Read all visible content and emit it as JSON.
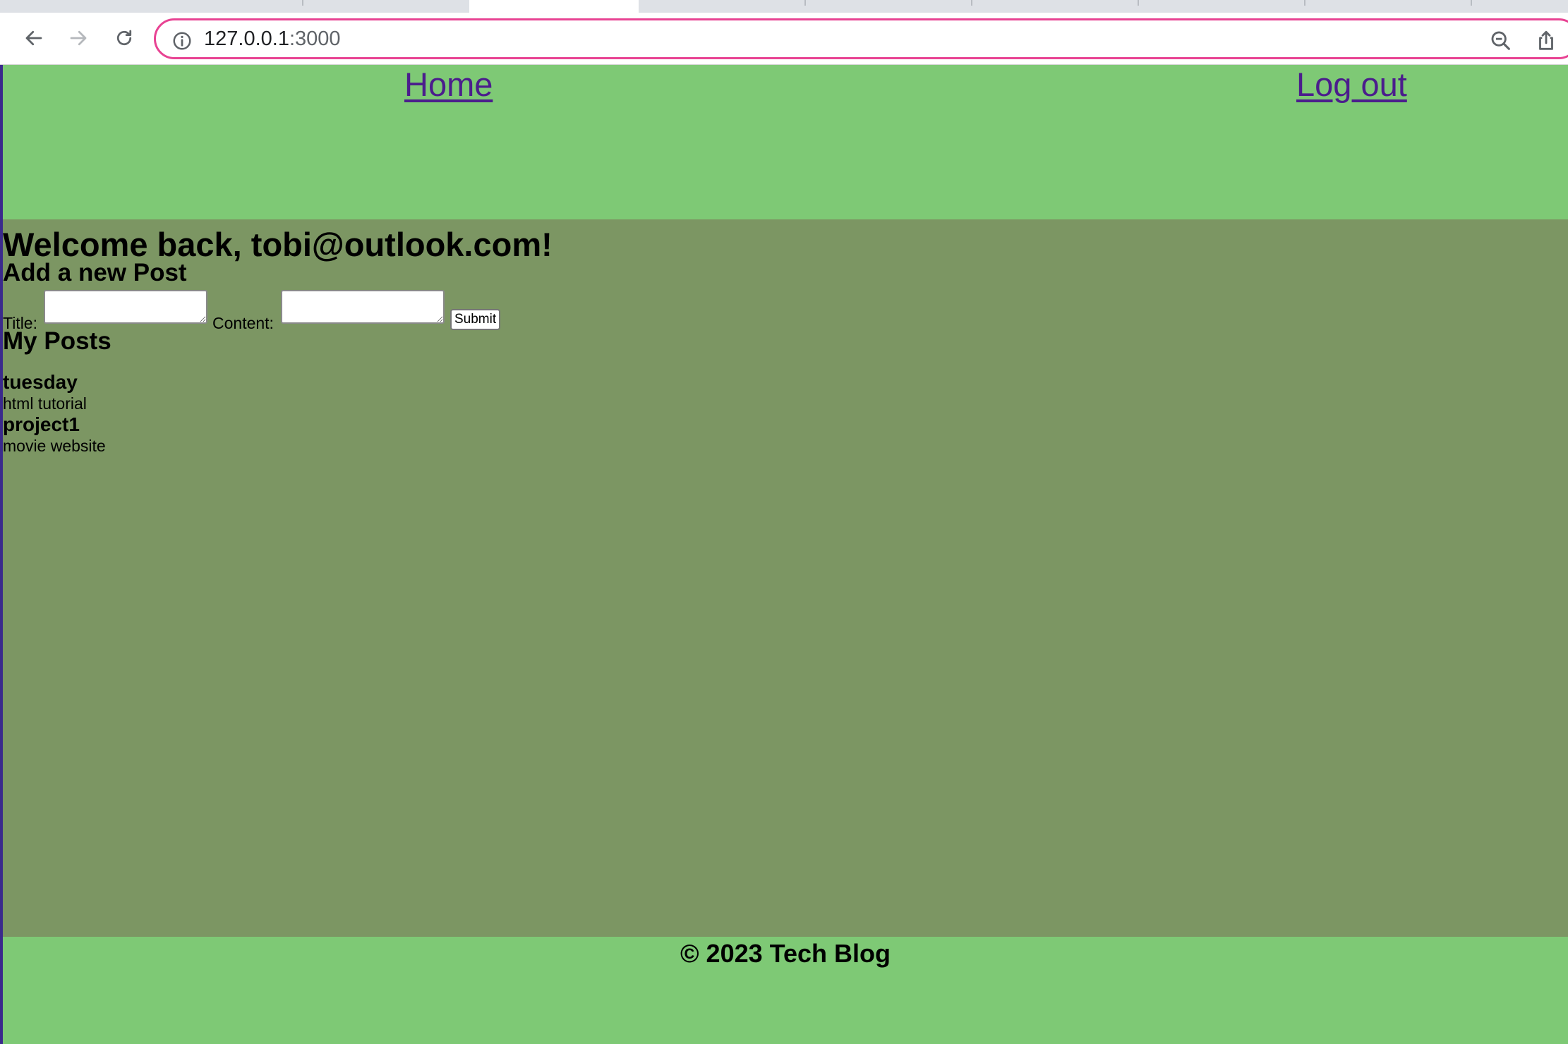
{
  "browser": {
    "url_host": "127.0.0.1",
    "url_port": ":3000",
    "back_icon": "arrow-left-icon",
    "forward_icon": "arrow-right-icon",
    "reload_icon": "reload-icon",
    "info_icon": "info-icon",
    "zoom_icon": "zoom-out-icon",
    "share_icon": "share-icon",
    "omnibox_border_color": "#e84393"
  },
  "nav": {
    "home_label": "Home",
    "logout_label": "Log out",
    "link_color": "#4b1d8c",
    "background_color": "#7ec975"
  },
  "main": {
    "welcome": "Welcome back, tobi@outlook.com!",
    "add_post_heading": "Add a new Post",
    "form": {
      "title_label": "Title:",
      "title_value": "",
      "content_label": "Content:",
      "content_value": "",
      "submit_label": "Submit"
    },
    "my_posts_heading": "My Posts",
    "posts": [
      {
        "title": "tuesday",
        "content": "html tutorial"
      },
      {
        "title": "project1",
        "content": "movie website"
      }
    ],
    "background_color": "#7c9663"
  },
  "footer": {
    "text": "© 2023 Tech Blog"
  }
}
